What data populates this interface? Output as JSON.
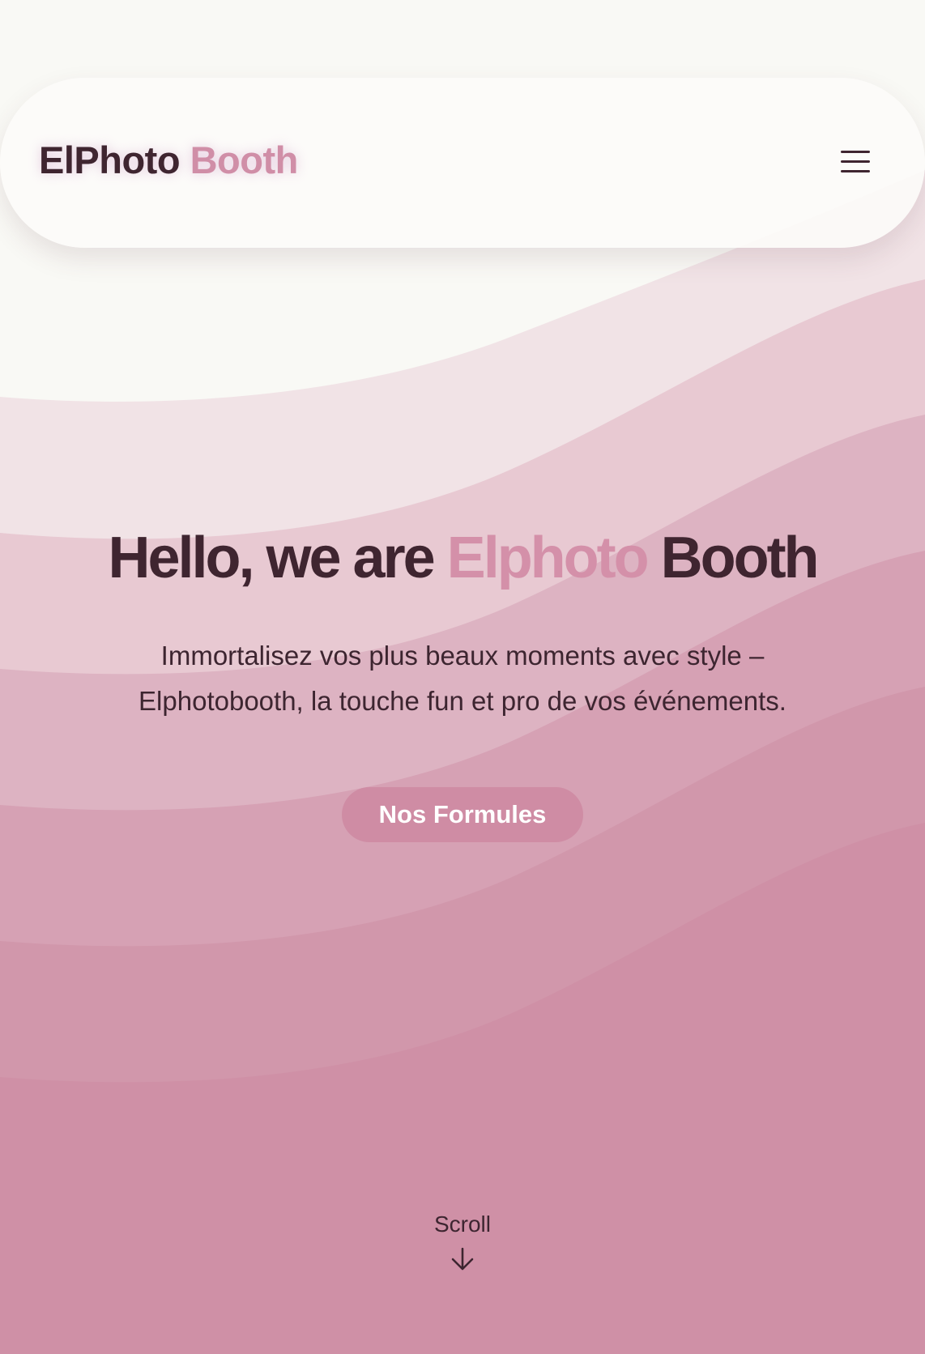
{
  "header": {
    "logo_part_1": "ElPhoto",
    "logo_part_2": "Booth",
    "menu_icon": "hamburger-icon"
  },
  "hero": {
    "title_part_1": "Hello, we are",
    "title_accent": "Elphoto",
    "title_part_2": "Booth",
    "subtitle_line_1": "Immortalisez vos plus beaux moments avec style –",
    "subtitle_line_2": "Elphotobooth, la touche fun et pro de vos événements.",
    "cta_label": "Nos Formules"
  },
  "scroll": {
    "label": "Scroll",
    "icon": "arrow-down-icon"
  },
  "colors": {
    "background": "#f9f9f5",
    "dark_text": "#3f2530",
    "accent_pink": "#d08ea7",
    "button": "#cf8ca4",
    "wave_1": "#f1e3e6",
    "wave_2": "#e8c9d2",
    "wave_3": "#ddb3c2",
    "wave_4": "#d6a1b4",
    "wave_5": "#d197ab",
    "wave_6": "#cf90a6"
  }
}
